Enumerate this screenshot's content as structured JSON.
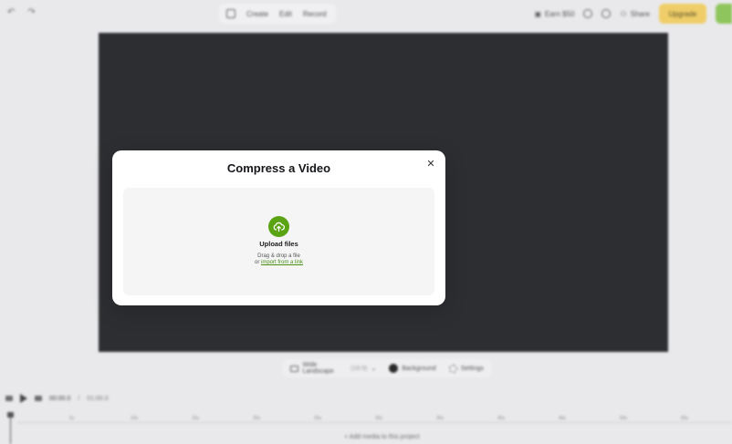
{
  "topbar": {
    "nav": [
      "Create",
      "Edit",
      "Record"
    ],
    "earn_label": "Earn $50",
    "share_label": "Share",
    "upgrade_label": "Upgrade"
  },
  "aspect": {
    "ratio_label": "Wide Landscape",
    "ratio_value": "(16:9)",
    "background_label": "Background",
    "settings_label": "Settings"
  },
  "player": {
    "current_time": "00:00.0",
    "separator": "/",
    "total_time": "01:00.0"
  },
  "timeline": {
    "ticks": [
      "5s",
      "10s",
      "15s",
      "20s",
      "25s",
      "30s",
      "35s",
      "40s",
      "45s",
      "50s",
      "55s"
    ],
    "add_media_label": "+ Add media to this project"
  },
  "modal": {
    "title": "Compress a Video",
    "upload_label": "Upload files",
    "drag_text": "Drag & drop a file",
    "or_text": "or",
    "import_link": "import from a link"
  },
  "colors": {
    "accent": "#5aa312",
    "upgrade": "#f2c94c",
    "canvas": "#05070a"
  }
}
